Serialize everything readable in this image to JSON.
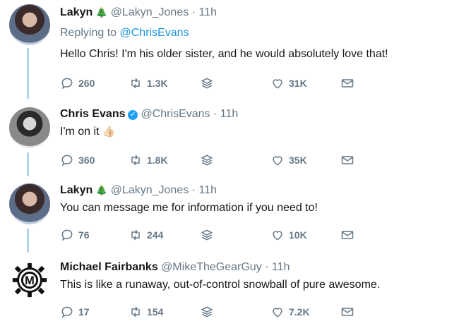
{
  "tweets": [
    {
      "name": "Lakyn",
      "badge": "🎄",
      "handle": "@Lakyn_Jones",
      "separator": "·",
      "time": "11h",
      "replying_prefix": "Replying to",
      "replying_to": "@ChrisEvans",
      "text": "Hello Chris! I'm his older sister, and he would absolutely love that!",
      "replies": "260",
      "retweets": "1.3K",
      "likes": "31K",
      "avatar": "lakyn-avatar"
    },
    {
      "name": "Chris Evans",
      "badge": "✓",
      "handle": "@ChrisEvans",
      "separator": "·",
      "time": "11h",
      "text": "I'm on it",
      "text_emoji": "👍🏻",
      "replies": "360",
      "retweets": "1.8K",
      "likes": "35K",
      "avatar": "chris-avatar"
    },
    {
      "name": "Lakyn",
      "badge": "🎄",
      "handle": "@Lakyn_Jones",
      "separator": "·",
      "time": "11h",
      "text": "You can message me for information if you need to!",
      "replies": "76",
      "retweets": "244",
      "likes": "10K",
      "avatar": "lakyn-avatar"
    },
    {
      "name": "Michael Fairbanks",
      "handle": "@MikeTheGearGuy",
      "separator": "·",
      "time": "11h",
      "text": "This is like a runaway, out-of-control snowball of pure awesome.",
      "replies": "17",
      "retweets": "154",
      "likes": "7.2K",
      "avatar": "gear-logo-avatar",
      "avatar_letter": "M"
    }
  ],
  "icons": {
    "reply": "reply-icon",
    "retweet": "retweet-icon",
    "stack": "stack-icon",
    "like": "heart-icon",
    "dm": "envelope-icon"
  },
  "colors": {
    "link": "#1b95e0",
    "muted": "#657786",
    "thread_line": "#aed6f1",
    "verified": "#1da1f2"
  }
}
